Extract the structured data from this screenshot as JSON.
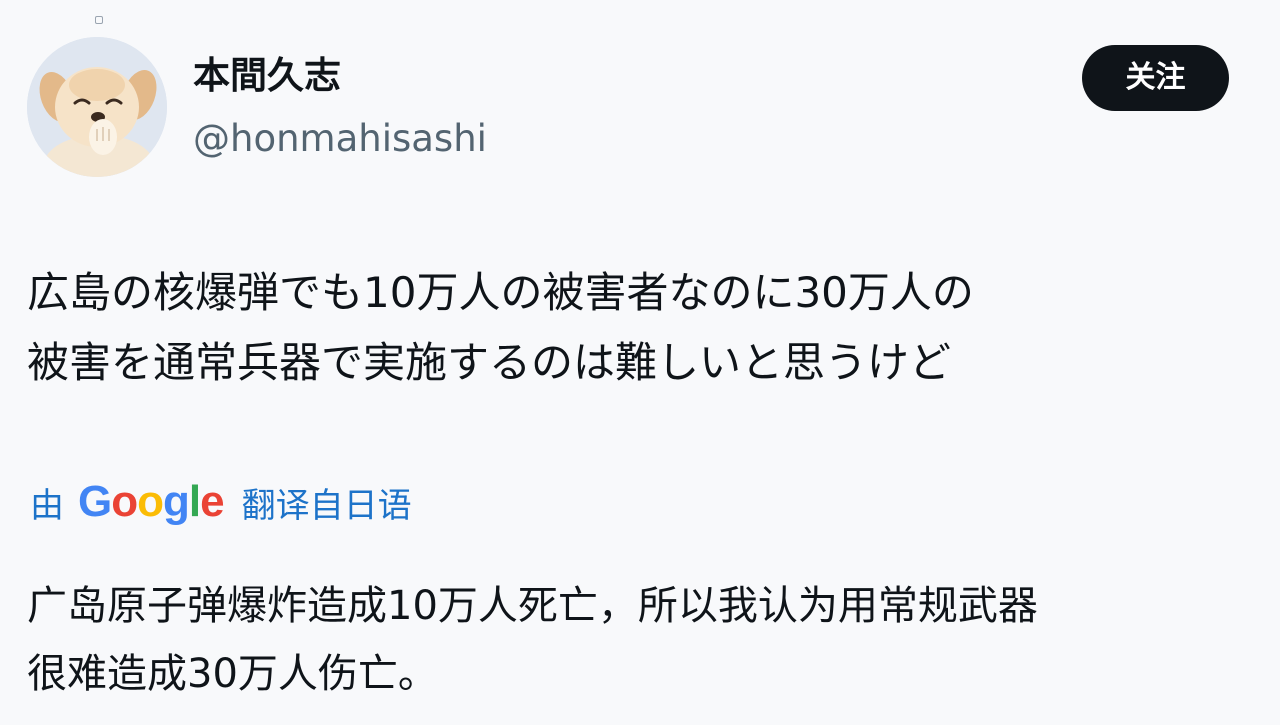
{
  "user": {
    "display_name": "本間久志",
    "handle": "@honmahisashi",
    "avatar_icon": "smiling-dog-avatar"
  },
  "follow_button": {
    "label": "关注",
    "bg_color": "#0f1419",
    "text_color": "#ffffff"
  },
  "tweet": {
    "lines": [
      "広島の核爆弾でも10万人の被害者なのに30万人の",
      "被害を通常兵器で実施するのは難しいと思うけど"
    ]
  },
  "translation_notice": {
    "prefix": "由",
    "provider": [
      "G",
      "o",
      "o",
      "g",
      "l",
      "e"
    ],
    "provider_colors": [
      "#4285F4",
      "#EA4335",
      "#FBBC05",
      "#4285F4",
      "#34A853",
      "#EA4335"
    ],
    "suffix": "翻译自日语",
    "link_color": "#1d73c9"
  },
  "translation": {
    "lines": [
      "广岛原子弹爆炸造成10万人死亡，所以我认为用常规武器",
      "很难造成30万人伤亡。"
    ]
  }
}
